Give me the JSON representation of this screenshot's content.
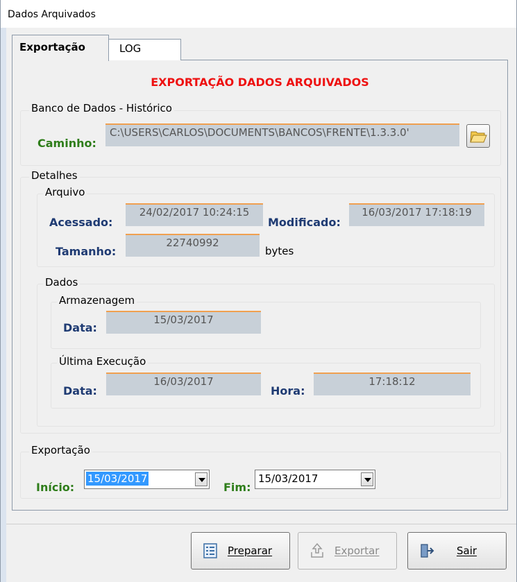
{
  "window": {
    "title": "Dados Arquivados"
  },
  "tabs": [
    {
      "label": "Exportação",
      "active": true
    },
    {
      "label": "LOG",
      "active": false
    }
  ],
  "heading": "EXPORTAÇÃO DADOS ARQUIVADOS",
  "banco": {
    "group_title": "Banco de Dados - Histórico",
    "caminho_label": "Caminho:",
    "caminho_value": "C:\\USERS\\CARLOS\\DOCUMENTS\\BANCOS\\FRENTE\\1.3.3.0'",
    "browse_icon": "folder-open-icon"
  },
  "detalhes": {
    "group_title": "Detalhes",
    "arquivo": {
      "group_title": "Arquivo",
      "acessado_label": "Acessado:",
      "acessado_value": "24/02/2017 10:24:15",
      "modificado_label": "Modificado:",
      "modificado_value": "16/03/2017 17:18:19",
      "tamanho_label": "Tamanho:",
      "tamanho_value": "22740992",
      "tamanho_unit": "bytes"
    },
    "dados": {
      "group_title": "Dados",
      "armazenagem": {
        "group_title": "Armazenagem",
        "data_label": "Data:",
        "data_value": "15/03/2017"
      },
      "ultima": {
        "group_title": "Última Execução",
        "data_label": "Data:",
        "data_value": "16/03/2017",
        "hora_label": "Hora:",
        "hora_value": "17:18:12"
      }
    }
  },
  "exportacao": {
    "group_title": "Exportação",
    "inicio_label": "Início:",
    "inicio_value": "15/03/2017",
    "fim_label": "Fim:",
    "fim_value": "15/03/2017"
  },
  "buttons": {
    "preparar": "Preparar",
    "exportar": "Exportar",
    "sair": "Sair"
  },
  "colors": {
    "heading": "#ee1111",
    "label_green": "#2e7d1a",
    "label_blue": "#1f3b73",
    "field_bg": "#c8d0d8",
    "field_border": "#f0a050"
  }
}
